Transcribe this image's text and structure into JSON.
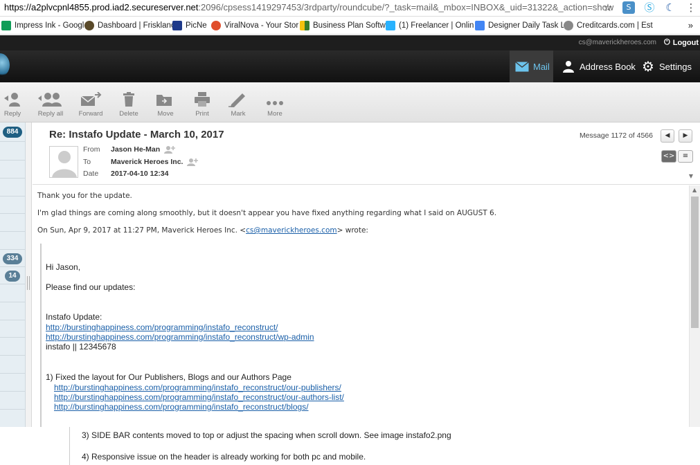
{
  "browser": {
    "url_scheme_host": "https://a2plvcpnl4855.prod.iad2.secureserver.net",
    "url_rest": ":2096/cpsess1419297453/3rdparty/roundcube/?_task=mail&_mbox=INBOX&_uid=31322&_action=show",
    "bookmarks": [
      {
        "label": "Impress Ink - Google",
        "color": "#0f9d58"
      },
      {
        "label": "Dashboard | Frisklanc",
        "color": "#333333"
      },
      {
        "label": "PicNe",
        "color": "#1e3a8a"
      },
      {
        "label": "ViralNova - Your Stor",
        "color": "#e04e2c"
      },
      {
        "label": "Business Plan Softwa",
        "color": "#3a7d2b"
      },
      {
        "label": "(1) Freelancer | Onlin",
        "color": "#29b2fe"
      },
      {
        "label": "Designer Daily Task L",
        "color": "#4285f4"
      },
      {
        "label": "Creditcards.com | Est",
        "color": "#555555"
      }
    ],
    "more": "»"
  },
  "app": {
    "user_email": "cs@maverickheroes.com",
    "logout_label": "Logout",
    "nav": [
      {
        "label": "Mail",
        "icon": "envelope-icon",
        "active": true
      },
      {
        "label": "Address Book",
        "icon": "person-icon",
        "active": false
      },
      {
        "label": "Settings",
        "icon": "gear-icon",
        "active": false
      }
    ]
  },
  "toolbar": {
    "reply": "Reply",
    "reply_all": "Reply all",
    "forward": "Forward",
    "delete": "Delete",
    "move": "Move",
    "print": "Print",
    "mark": "Mark",
    "more": "More"
  },
  "folders": {
    "badges": [
      "884",
      "334",
      "14"
    ]
  },
  "message": {
    "subject": "Re: Instafo Update - March 10, 2017",
    "from_label": "From",
    "from": "Jason He-Man",
    "to_label": "To",
    "to": "Maverick Heroes Inc.",
    "date_label": "Date",
    "date": "2017-04-10 12:34",
    "count": "Message 1172 of 4566",
    "view_html": "<>",
    "view_text": "≡"
  },
  "body": {
    "line1": "Thank you for the update.",
    "line2": "I'm glad things are coming along smoothly, but it doesn't appear you have fixed anything regarding what I said on AUGUST 6.",
    "quote_intro_pre": "On Sun, Apr 9, 2017 at 11:27 PM, Maverick Heroes Inc. <",
    "quote_intro_email": "cs@maverickheroes.com",
    "quote_intro_post": "> wrote:",
    "greeting": "Hi Jason,",
    "find_updates": "Please find our updates:",
    "update_title": "Instafo Update:",
    "link1": "http://burstinghappiness.com/programming/instafo_reconstruct/",
    "link2": "http://burstinghappiness.com/programming/instafo_reconstruct/wp-admin",
    "creds": "instafo || 12345678",
    "item1": "1) Fixed the layout for Our Publishers, Blogs and our Authors Page",
    "item1_link1": "http://burstinghappiness.com/programming/instafo_reconstruct/our-publishers/",
    "item1_link2": "http://burstinghappiness.com/programming/instafo_reconstruct/our-authors-list/",
    "item1_link3": "http://burstinghappiness.com/programming/instafo_reconstruct/blogs/",
    "item3": "3) SIDE BAR contents moved to top or adjust the spacing when scroll down. See image instafo2.png",
    "item4": "4) Responsive issue on the header is already working for both pc and mobile."
  }
}
